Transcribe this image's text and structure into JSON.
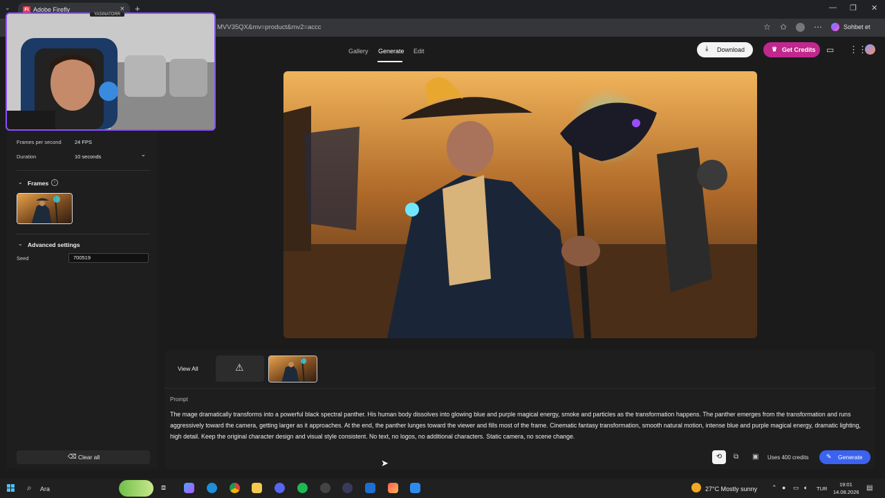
{
  "browser": {
    "tab_title": "Adobe Firefly",
    "tab_close": "×",
    "new_tab": "+",
    "url_fragment": "MVV35QX&mv=product&mv2=accc",
    "sohbet_label": "Sohbet et",
    "window_min": "—",
    "window_restore": "❐",
    "window_close": "✕"
  },
  "webcam": {
    "label": "YASINATORR"
  },
  "header": {
    "nav": [
      "Gallery",
      "Generate",
      "Edit"
    ],
    "download_label": "Download",
    "credits_label": "Get Credits"
  },
  "sidebar": {
    "fps_label": "Frames per second",
    "fps_value": "24 FPS",
    "duration_label": "Duration",
    "duration_value": "10 seconds",
    "frames_heading": "Frames",
    "advanced_heading": "Advanced settings",
    "seed_label": "Seed",
    "seed_value": "700519",
    "clear_label": "Clear all"
  },
  "bottom": {
    "view_all": "View All",
    "prompt_label": "Prompt",
    "prompt_text": "The mage dramatically transforms into a powerful black spectral panther. His human body dissolves into glowing blue and purple magical energy, smoke and particles as the transformation happens. The panther emerges from the transformation and runs aggressively toward the camera, getting larger as it approaches. At the end, the panther lunges toward the viewer and fills most of the frame. Cinematic fantasy transformation, smooth natural motion, intense blue and purple magical energy, dramatic lighting, high detail. Keep the original character design and visual style consistent. No text, no logos, no additional characters. Static camera, no scene change.",
    "uses_credits": "Uses 400 credits",
    "generate_label": "Generate"
  },
  "taskbar": {
    "search_placeholder": "Ara",
    "weather": "27°C  Mostly sunny",
    "lang": "TUR",
    "time": "19:01",
    "date": "14.08.2026"
  },
  "colors": {
    "accent_blue": "#3b63f0",
    "credits_magenta": "#c0288e",
    "webcam_border": "#8a4fff"
  }
}
